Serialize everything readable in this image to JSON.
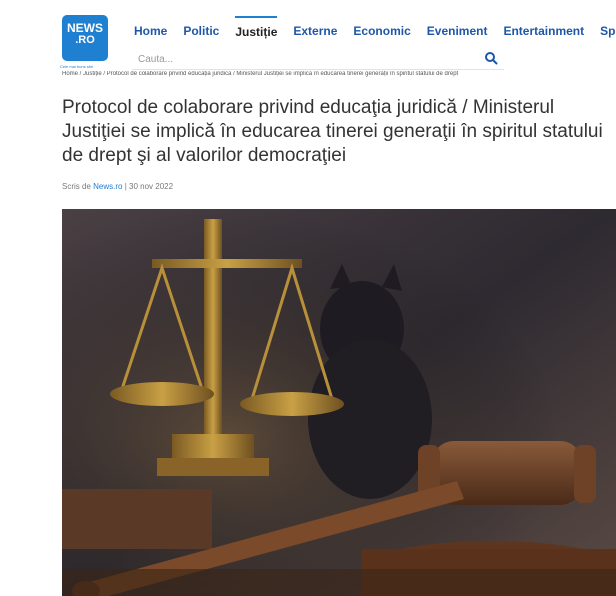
{
  "header": {
    "logo": {
      "line1": "NEWS",
      "line2": ".RO",
      "tagline": "Cele mai bune știri"
    },
    "nav": [
      {
        "label": "Home",
        "active": false
      },
      {
        "label": "Politic",
        "active": false
      },
      {
        "label": "Justiție",
        "active": true
      },
      {
        "label": "Externe",
        "active": false
      },
      {
        "label": "Economic",
        "active": false
      },
      {
        "label": "Eveniment",
        "active": false
      },
      {
        "label": "Entertainment",
        "active": false
      },
      {
        "label": "Sport",
        "active": false
      }
    ],
    "search": {
      "placeholder": "Cauta...",
      "icon": "search-icon"
    }
  },
  "breadcrumb": "Home / Justiție / Protocol de colaborare privind educația juridică / Ministerul Justiției se implică în educarea tinerei generații în spiritul statului de drept",
  "article": {
    "title": "Protocol de colaborare privind educaţia juridică / Ministerul Justiţiei se implică în educarea tinerei generaţii în spiritul statului de drept şi al valorilor democraţiei",
    "byline": {
      "prefix": "Scris de",
      "author": "News.ro",
      "separator": "|",
      "date": "30 nov 2022"
    }
  },
  "colors": {
    "brand": "#1f7fd1",
    "nav_link": "#1f57a8",
    "title": "#333333"
  }
}
